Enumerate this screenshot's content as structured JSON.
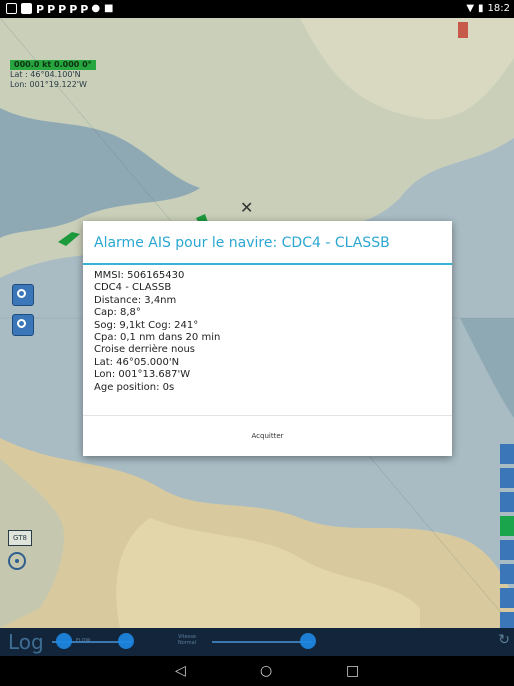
{
  "statusbar": {
    "icons": [
      "app-icon",
      "notification-icon",
      "p-icon",
      "p-icon",
      "p-icon",
      "p-icon",
      "p-icon",
      "cast-icon",
      "stop-icon"
    ],
    "time": "18:2"
  },
  "map": {
    "coords": {
      "status": "000.0 kt 0.000 0°",
      "lat": "Lat : 46°04.100'N",
      "lon": "Lon: 001°19.122'W"
    },
    "badge": "GT8"
  },
  "dialog": {
    "title": "Alarme AIS pour le navire: CDC4 - CLASSB",
    "lines": [
      "MMSI: 506165430",
      "CDC4 - CLASSB",
      "Distance: 3,4nm",
      "Cap: 8,8°",
      "Sog: 9,1kt Cog: 241°",
      "Cpa: 0,1 nm dans 20 min",
      "Croise derrière nous",
      "Lat: 46°05.000'N",
      "Lon: 001°13.687'W",
      "Age position: 0s"
    ],
    "ack_label": "Acquitter"
  },
  "logbar": {
    "label": "Log",
    "speed_label": "FLOW",
    "center_label": "Vitesse Normal"
  },
  "colors": {
    "accent": "#2aa7d2",
    "map_green": "#27a53f",
    "tool_blue": "#3b77b8"
  }
}
